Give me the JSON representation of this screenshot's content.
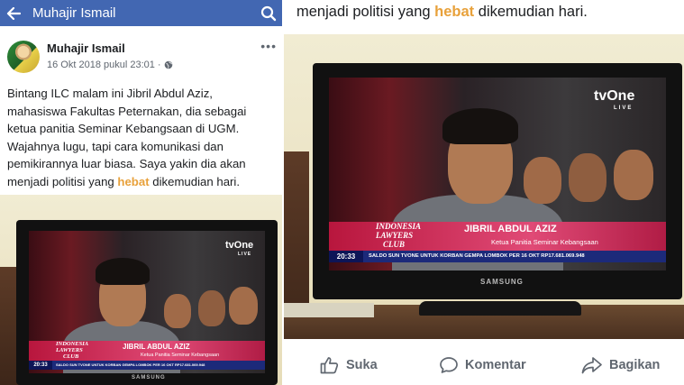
{
  "header": {
    "back_icon": "arrow-left-icon",
    "title": "Muhajir Ismail",
    "search_icon": "search-icon",
    "color": "#4267b2"
  },
  "post": {
    "author": "Muhajir Ismail",
    "timestamp": "16 Okt 2018 pukul 23:01",
    "separator": "·",
    "privacy_icon": "globe-icon",
    "more_icon": "more-dots-icon",
    "lines": [
      "Bintang ILC malam ini Jibril Abdul Aziz,",
      "mahasiswa Fakultas Peternakan, dia sebagai",
      "ketua panitia Seminar Kebangsaan di UGM.",
      "Wajahnya lugu, tapi cara komunikasi dan",
      "pemikirannya luar biasa. Saya yakin dia akan"
    ],
    "last_line_prefix": "menjadi politisi yang ",
    "highlight_word": "hebat",
    "last_line_suffix": " dikemudian hari.",
    "highlight_color": "#e8a13b"
  },
  "right_caption": {
    "prefix": "menjadi politisi yang ",
    "highlight_word": "hebat",
    "suffix": " dikemudian hari."
  },
  "tv": {
    "channel_logo": "tvOne",
    "channel_live": "LIVE",
    "show_name_1": "INDONESIA",
    "show_name_2": "LAWYERS",
    "show_name_3": "CLUB",
    "guest_name": "JIBRIL ABDUL AZIZ",
    "guest_role": "Ketua Panitia Seminar Kebangsaan",
    "clock": "20:33",
    "ticker": "SALDO SUN TVONE UNTUK KORBAN GEMPA LOMBOK PER 16 OKT RP17.681.069.948",
    "brand": "SAMSUNG"
  },
  "actions": {
    "like_label": "Suka",
    "like_icon": "thumbs-up-icon",
    "comment_label": "Komentar",
    "comment_icon": "comment-icon",
    "share_label": "Bagikan",
    "share_icon": "share-icon"
  }
}
